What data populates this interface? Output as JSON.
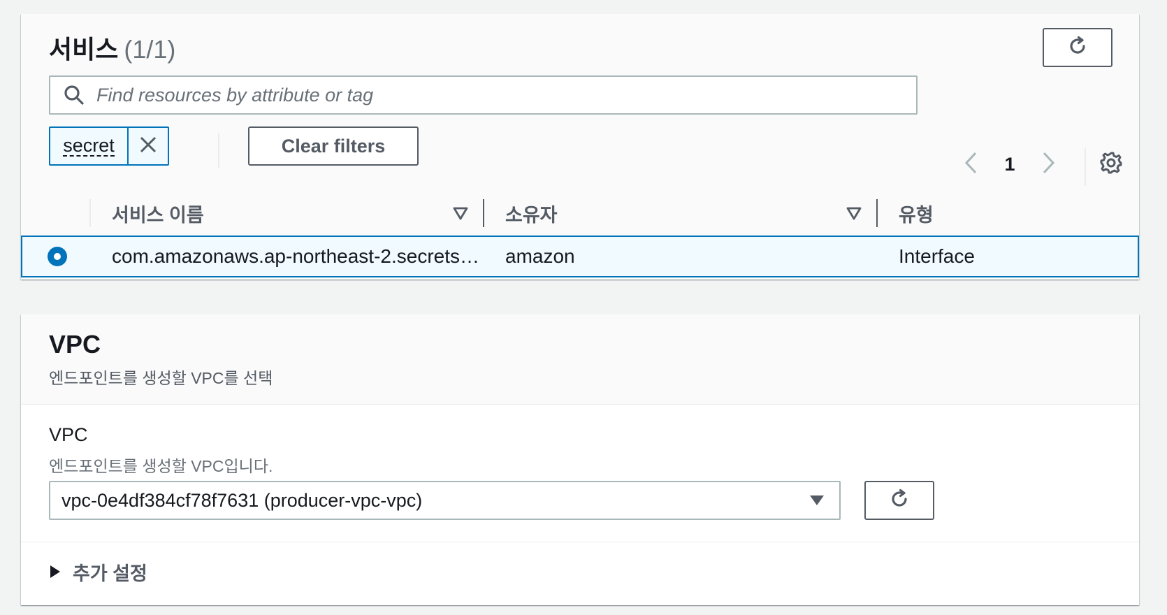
{
  "services_panel": {
    "title": "서비스",
    "count": "(1/1)",
    "search_placeholder": "Find resources by attribute or tag",
    "filter_token": "secret",
    "clear_filters_label": "Clear filters",
    "page_number": "1",
    "columns": [
      "서비스 이름",
      "소유자",
      "유형"
    ],
    "rows": [
      {
        "name": "com.amazonaws.ap-northeast-2.secrets…",
        "owner": "amazon",
        "type": "Interface",
        "selected": true
      }
    ],
    "icons": {
      "refresh": "refresh-icon",
      "search": "search-icon",
      "token_remove": "close-icon",
      "prev": "chevron-left-icon",
      "next": "chevron-right-icon",
      "settings": "gear-icon",
      "sort": "caret-down-icon"
    }
  },
  "vpc_panel": {
    "title": "VPC",
    "description": "엔드포인트를 생성할 VPC를 선택",
    "field_label": "VPC",
    "field_description": "엔드포인트를 생성할 VPC입니다.",
    "selected_vpc": "vpc-0e4df384cf78f7631 (producer-vpc-vpc)",
    "additional_settings_label": "추가 설정"
  },
  "colors": {
    "background": "#f2f3f3",
    "accent": "#0073bb",
    "selected_row": "#f1faff",
    "text": "#16191f",
    "secondary_text": "#545b64"
  }
}
